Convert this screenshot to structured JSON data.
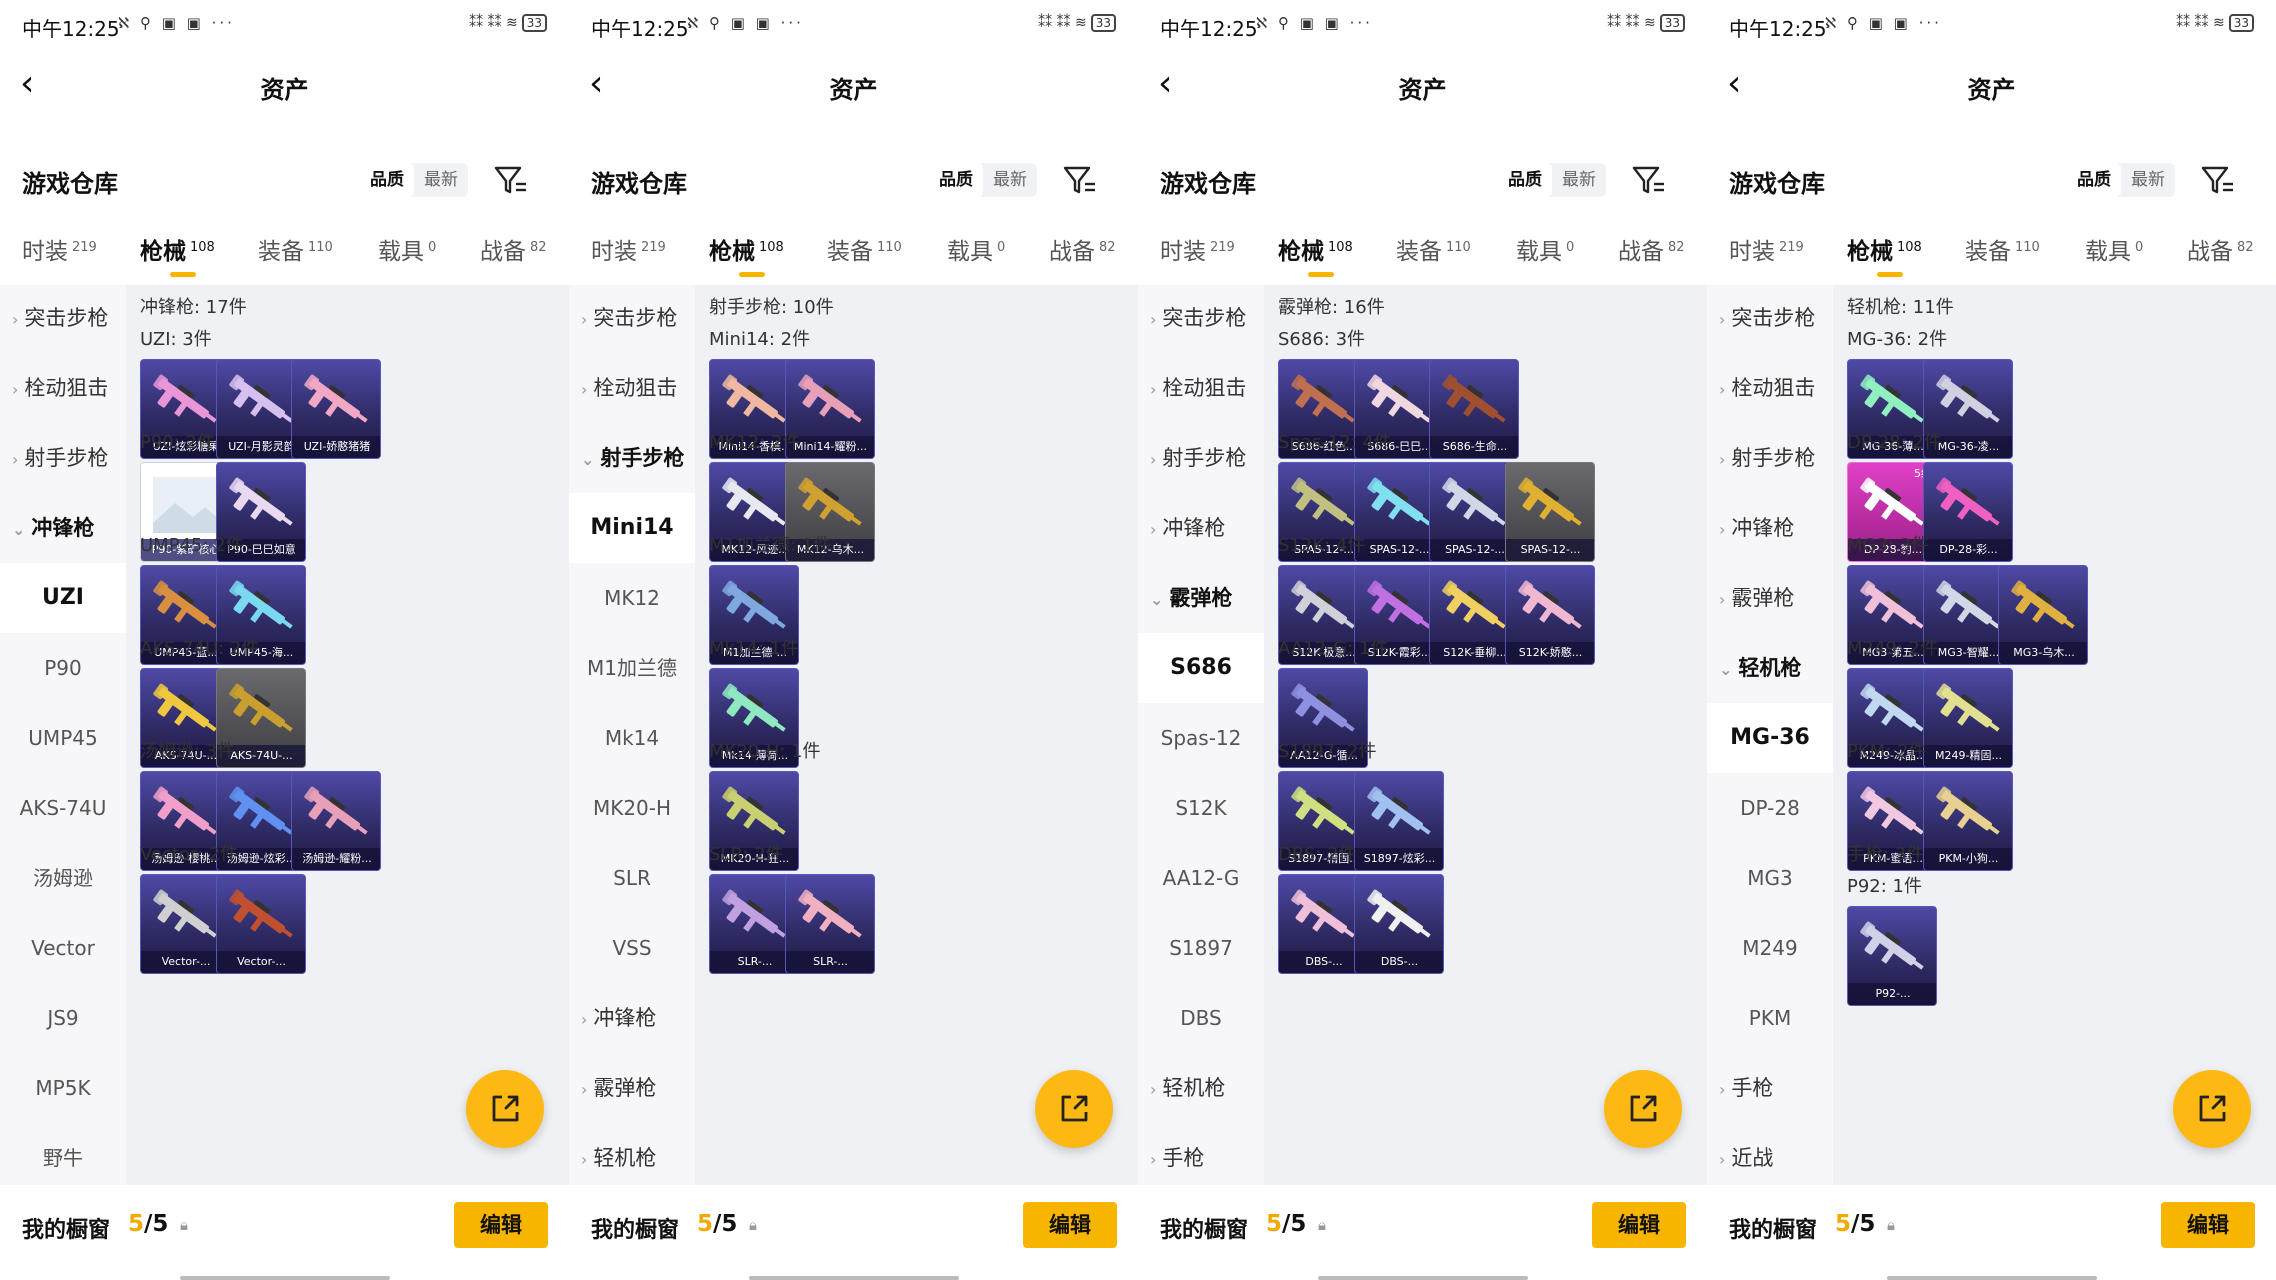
{
  "panels": [
    {
      "status": {
        "time": "中午12:25",
        "icons": "ℵ ⚲ ▣ ▣ ···",
        "signal": "⁑⁑ ⁑⁑ ≋",
        "battery": "33"
      },
      "page_title": "资产",
      "warehouse_title": "游戏仓库",
      "sort": {
        "quality": "品质",
        "latest": "最新"
      },
      "tabs": [
        {
          "label": "时装",
          "count": "219"
        },
        {
          "label": "枪械",
          "count": "108"
        },
        {
          "label": "装备",
          "count": "110"
        },
        {
          "label": "载具",
          "count": "0"
        },
        {
          "label": "战备",
          "count": "82"
        }
      ],
      "sidebar": [
        {
          "label": "突击步枪",
          "kind": "cat"
        },
        {
          "label": "栓动狙击",
          "kind": "cat"
        },
        {
          "label": "射手步枪",
          "kind": "cat"
        },
        {
          "label": "冲锋枪",
          "kind": "exp"
        },
        {
          "label": "UZI",
          "kind": "sel"
        },
        {
          "label": "P90",
          "kind": "sub"
        },
        {
          "label": "UMP45",
          "kind": "sub"
        },
        {
          "label": "AKS-74U",
          "kind": "sub"
        },
        {
          "label": "汤姆逊",
          "kind": "sub"
        },
        {
          "label": "Vector",
          "kind": "sub"
        },
        {
          "label": "JS9",
          "kind": "sub"
        },
        {
          "label": "MP5K",
          "kind": "sub"
        },
        {
          "label": "野牛",
          "kind": "sub"
        }
      ],
      "header": "冲锋枪: 17件",
      "groups": [
        {
          "title": "UZI: 3件",
          "items": [
            {
              "label": "UZI-炫彩糖果",
              "color": "#e896d8"
            },
            {
              "label": "UZI-月影灵韵",
              "color": "#d6c0f0"
            },
            {
              "label": "UZI-娇憨猪猪",
              "color": "#f2a8c4"
            }
          ]
        },
        {
          "title": "P90: 2件",
          "items": [
            {
              "label": "P90-紫矿核心",
              "color": "#c9d6e8",
              "style": "white"
            },
            {
              "label": "P90-巳巳如意",
              "color": "#e8d8f0"
            }
          ]
        },
        {
          "title": "UMP45: 2件",
          "items": [
            {
              "label": "UMP45-蓝...",
              "color": "#d89040"
            },
            {
              "label": "UMP45-海...",
              "color": "#7ad8f0"
            }
          ]
        },
        {
          "title": "AKS-74U: 2件",
          "items": [
            {
              "label": "AKS-74U-...",
              "color": "#f0c840"
            },
            {
              "label": "AKS-74U-...",
              "color": "#c9a030",
              "style": "gray"
            }
          ]
        },
        {
          "title": "汤姆逊: 3件",
          "items": [
            {
              "label": "汤姆逊-樱桃...",
              "color": "#f0a0c8"
            },
            {
              "label": "汤姆逊-炫彩...",
              "color": "#6090f0"
            },
            {
              "label": "汤姆逊-耀粉...",
              "color": "#e8a0b8"
            }
          ]
        },
        {
          "title": "Vector: 2件",
          "items": [
            {
              "label": "Vector-...",
              "color": "#d0d0d0"
            },
            {
              "label": "Vector-...",
              "color": "#c05030"
            }
          ]
        }
      ],
      "cabinet": {
        "label": "我的橱窗",
        "used": "5",
        "total": "/5",
        "edit": "编辑"
      }
    },
    {
      "status": {
        "time": "中午12:25",
        "icons": "ℵ ⚲ ▣ ▣ ···",
        "signal": "⁑⁑ ⁑⁑ ≋",
        "battery": "33"
      },
      "page_title": "资产",
      "warehouse_title": "游戏仓库",
      "sort": {
        "quality": "品质",
        "latest": "最新"
      },
      "tabs": [
        {
          "label": "时装",
          "count": "219"
        },
        {
          "label": "枪械",
          "count": "108"
        },
        {
          "label": "装备",
          "count": "110"
        },
        {
          "label": "载具",
          "count": "0"
        },
        {
          "label": "战备",
          "count": "82"
        }
      ],
      "sidebar": [
        {
          "label": "突击步枪",
          "kind": "cat"
        },
        {
          "label": "栓动狙击",
          "kind": "cat"
        },
        {
          "label": "射手步枪",
          "kind": "exp"
        },
        {
          "label": "Mini14",
          "kind": "sel"
        },
        {
          "label": "MK12",
          "kind": "sub"
        },
        {
          "label": "M1加兰德",
          "kind": "sub"
        },
        {
          "label": "Mk14",
          "kind": "sub"
        },
        {
          "label": "MK20-H",
          "kind": "sub"
        },
        {
          "label": "SLR",
          "kind": "sub"
        },
        {
          "label": "VSS",
          "kind": "sub"
        },
        {
          "label": "冲锋枪",
          "kind": "cat"
        },
        {
          "label": "霰弹枪",
          "kind": "cat"
        },
        {
          "label": "轻机枪",
          "kind": "cat"
        }
      ],
      "header": "射手步枪: 10件",
      "groups": [
        {
          "title": "Mini14: 2件",
          "items": [
            {
              "label": "Mini14-香槟...",
              "color": "#f0b8a0"
            },
            {
              "label": "Mini14-耀粉...",
              "color": "#e8a0b8"
            }
          ]
        },
        {
          "title": "MK12: 2件",
          "items": [
            {
              "label": "MK12-风迹...",
              "color": "#e8e8f0"
            },
            {
              "label": "MK12-乌木...",
              "color": "#d0a030",
              "style": "gray"
            }
          ]
        },
        {
          "title": "M1加兰德: 1件",
          "items": [
            {
              "label": "M1加兰德-...",
              "color": "#80a8e0"
            }
          ]
        },
        {
          "title": "Mk14: 1件",
          "items": [
            {
              "label": "Mk14-薄荷...",
              "color": "#90e8c0"
            }
          ]
        },
        {
          "title": "MK20-H: 1件",
          "items": [
            {
              "label": "MK20-H-狂...",
              "color": "#c8d070"
            }
          ]
        },
        {
          "title": "SLR: 2件",
          "items": [
            {
              "label": "SLR-...",
              "color": "#c0a0e0"
            },
            {
              "label": "SLR-...",
              "color": "#f0b0c0"
            }
          ]
        }
      ],
      "cabinet": {
        "label": "我的橱窗",
        "used": "5",
        "total": "/5",
        "edit": "编辑"
      }
    },
    {
      "status": {
        "time": "中午12:25",
        "icons": "ℵ ⚲ ▣ ▣ ···",
        "signal": "⁑⁑ ⁑⁑ ≋",
        "battery": "33"
      },
      "page_title": "资产",
      "warehouse_title": "游戏仓库",
      "sort": {
        "quality": "品质",
        "latest": "最新"
      },
      "tabs": [
        {
          "label": "时装",
          "count": "219"
        },
        {
          "label": "枪械",
          "count": "108"
        },
        {
          "label": "装备",
          "count": "110"
        },
        {
          "label": "载具",
          "count": "0"
        },
        {
          "label": "战备",
          "count": "82"
        }
      ],
      "sidebar": [
        {
          "label": "突击步枪",
          "kind": "cat"
        },
        {
          "label": "栓动狙击",
          "kind": "cat"
        },
        {
          "label": "射手步枪",
          "kind": "cat"
        },
        {
          "label": "冲锋枪",
          "kind": "cat"
        },
        {
          "label": "霰弹枪",
          "kind": "exp"
        },
        {
          "label": "S686",
          "kind": "sel"
        },
        {
          "label": "Spas-12",
          "kind": "sub"
        },
        {
          "label": "S12K",
          "kind": "sub"
        },
        {
          "label": "AA12-G",
          "kind": "sub"
        },
        {
          "label": "S1897",
          "kind": "sub"
        },
        {
          "label": "DBS",
          "kind": "sub"
        },
        {
          "label": "轻机枪",
          "kind": "cat"
        },
        {
          "label": "手枪",
          "kind": "cat"
        }
      ],
      "header": "霰弹枪: 16件",
      "groups": [
        {
          "title": "S686: 3件",
          "items": [
            {
              "label": "S686-红色...",
              "color": "#c07050"
            },
            {
              "label": "S686-巳巳...",
              "color": "#f0d8e0"
            },
            {
              "label": "S686-生命...",
              "color": "#a05030"
            }
          ]
        },
        {
          "title": "Spas-12: 4件",
          "items": [
            {
              "label": "SPAS-12-...",
              "color": "#c0c080"
            },
            {
              "label": "SPAS-12-...",
              "color": "#80e0f0"
            },
            {
              "label": "SPAS-12-...",
              "color": "#d0d8e8"
            },
            {
              "label": "SPAS-12-...",
              "color": "#e0b030",
              "style": "gray"
            }
          ]
        },
        {
          "title": "S12K: 4件",
          "items": [
            {
              "label": "S12K-极意...",
              "color": "#d0d0d8"
            },
            {
              "label": "S12K-霞彩...",
              "color": "#c070e0"
            },
            {
              "label": "S12K-垂柳...",
              "color": "#f0d060"
            },
            {
              "label": "S12K-娇憨...",
              "color": "#f0b8d0"
            }
          ]
        },
        {
          "title": "AA12-G: 1件",
          "items": [
            {
              "label": "AA12-G-循...",
              "color": "#9090e0"
            }
          ]
        },
        {
          "title": "S1897: 2件",
          "items": [
            {
              "label": "S1897-精固...",
              "color": "#d0e080"
            },
            {
              "label": "S1897-炫彩...",
              "color": "#a0c0f0"
            }
          ]
        },
        {
          "title": "DBS: 2件",
          "items": [
            {
              "label": "DBS-...",
              "color": "#f0c0d8"
            },
            {
              "label": "DBS-...",
              "color": "#f0f0f0"
            }
          ]
        }
      ],
      "cabinet": {
        "label": "我的橱窗",
        "used": "5",
        "total": "/5",
        "edit": "编辑"
      }
    },
    {
      "status": {
        "time": "中午12:25",
        "icons": "ℵ ⚲ ▣ ▣ ···",
        "signal": "⁑⁑ ⁑⁑ ≋",
        "battery": "33"
      },
      "page_title": "资产",
      "warehouse_title": "游戏仓库",
      "sort": {
        "quality": "品质",
        "latest": "最新"
      },
      "tabs": [
        {
          "label": "时装",
          "count": "219"
        },
        {
          "label": "枪械",
          "count": "108"
        },
        {
          "label": "装备",
          "count": "110"
        },
        {
          "label": "载具",
          "count": "0"
        },
        {
          "label": "战备",
          "count": "82"
        }
      ],
      "sidebar": [
        {
          "label": "突击步枪",
          "kind": "cat"
        },
        {
          "label": "栓动狙击",
          "kind": "cat"
        },
        {
          "label": "射手步枪",
          "kind": "cat"
        },
        {
          "label": "冲锋枪",
          "kind": "cat"
        },
        {
          "label": "霰弹枪",
          "kind": "cat"
        },
        {
          "label": "轻机枪",
          "kind": "exp"
        },
        {
          "label": "MG-36",
          "kind": "sel"
        },
        {
          "label": "DP-28",
          "kind": "sub"
        },
        {
          "label": "MG3",
          "kind": "sub"
        },
        {
          "label": "M249",
          "kind": "sub"
        },
        {
          "label": "PKM",
          "kind": "sub"
        },
        {
          "label": "手枪",
          "kind": "cat"
        },
        {
          "label": "近战",
          "kind": "cat"
        }
      ],
      "header": "轻机枪: 11件",
      "groups": [
        {
          "title": "MG-36: 2件",
          "items": [
            {
              "label": "MG-36-薄...",
              "color": "#90f0c0"
            },
            {
              "label": "MG-36-凌...",
              "color": "#d0d0e0"
            }
          ]
        },
        {
          "title": "DP-28: 2件",
          "items": [
            {
              "label": "DP-28-豹...",
              "color": "#ffffff",
              "style": "pink",
              "badge": "5级"
            },
            {
              "label": "DP-28-彩...",
              "color": "#f060c0"
            }
          ]
        },
        {
          "title": "MG3: 3件",
          "items": [
            {
              "label": "MG3-第五...",
              "color": "#f0c0d8"
            },
            {
              "label": "MG3-智耀...",
              "color": "#d0d8e8"
            },
            {
              "label": "MG3-乌木...",
              "color": "#e0b040"
            }
          ]
        },
        {
          "title": "M249: 2件",
          "items": [
            {
              "label": "M249-冰晶...",
              "color": "#c0d8f0"
            },
            {
              "label": "M249-精固...",
              "color": "#e0e090"
            }
          ]
        },
        {
          "title": "PKM: 2件",
          "items": [
            {
              "label": "PKM-蜜语...",
              "color": "#f0c8e0"
            },
            {
              "label": "PKM-小狗...",
              "color": "#e8d090"
            }
          ]
        },
        {
          "title": "手枪: 3件",
          "items": []
        },
        {
          "title": "P92: 1件",
          "items": [
            {
              "label": "P92-...",
              "color": "#d0d0e8"
            }
          ]
        }
      ],
      "cabinet": {
        "label": "我的橱窗",
        "used": "5",
        "total": "/5",
        "edit": "编辑"
      }
    }
  ]
}
